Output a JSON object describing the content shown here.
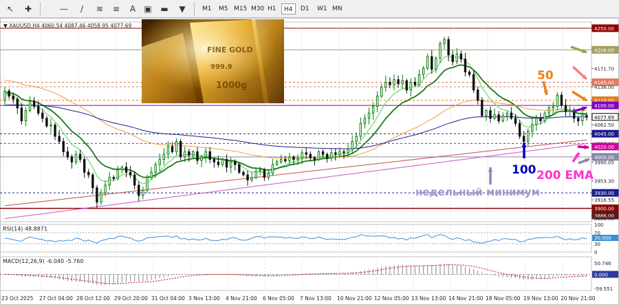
{
  "toolbar": {
    "icons": [
      "cursor-icon",
      "crosshair-icon",
      "horizontal-line-icon",
      "trend-line-icon",
      "channel-icon",
      "fibonacci-icon",
      "text-icon",
      "label-icon",
      "shapes-icon"
    ],
    "timeframes": [
      "M1",
      "M5",
      "M15",
      "M30",
      "H1",
      "H4",
      "D1",
      "W1",
      "MN"
    ],
    "active_timeframe": "H4"
  },
  "main_panel": {
    "symbol_info": "XAUUSD,H4  4060.54 4087.46 4058.95 4077.69",
    "price_ticks": [
      "4250.00",
      "4208.00",
      "4171.70",
      "4145.00",
      "4136.00",
      "4110.00",
      "4100.00",
      "4077.69",
      "4062.50",
      "4045.00",
      "4026.00",
      "4020.00",
      "4000.00",
      "3990.05",
      "3953.30",
      "3930.00",
      "3916.55",
      "3900.00",
      "3886.00",
      "3880.50"
    ],
    "annotations": {
      "ema50": "50",
      "ema100": "100",
      "ema200": "200 EMA",
      "weekly_low": "недельный минимум"
    }
  },
  "rsi_panel": {
    "label": "RSI(14) 48.8871",
    "ticks": [
      "100",
      "70",
      "30.000",
      "30",
      "0"
    ]
  },
  "macd_panel": {
    "label": "MACD(12,26,9) -6.040 -5.760",
    "ticks": [
      "50.746",
      "0.000",
      "-59.551"
    ]
  },
  "time_axis": [
    "23 Oct 2025",
    "27 Oct 04:00",
    "28 Oct 12:00",
    "29 Oct 20:00",
    "31 Oct 04:00",
    "3 Nov 13:00",
    "4 Nov 21:00",
    "6 Nov 05:00",
    "7 Nov 13:00",
    "10 Nov 21:00",
    "12 Nov 05:00",
    "13 Nov 13:00",
    "14 Nov 21:00",
    "18 Nov 05:00",
    "19 Nov 13:00",
    "20 Nov 21:00"
  ],
  "colors": {
    "bull": "#008000",
    "bear": "#111111",
    "ema_fast": "#8fe08f",
    "ema_mid": "#1a7a1a",
    "ema50": "#e8a040",
    "ema100": "#1c1c8c",
    "ema200_red": "#c0504d",
    "ema200_mag": "#cc55bb",
    "level_olive": "#a0a060",
    "level_salmon": "#e07a5f",
    "level_orange": "#e07a20",
    "level_purple": "#8000c0",
    "level_blue": "#1c1c8c",
    "level_magenta": "#d000a0",
    "level_grey": "#8888aa",
    "level_red": "#8b0000"
  }
}
